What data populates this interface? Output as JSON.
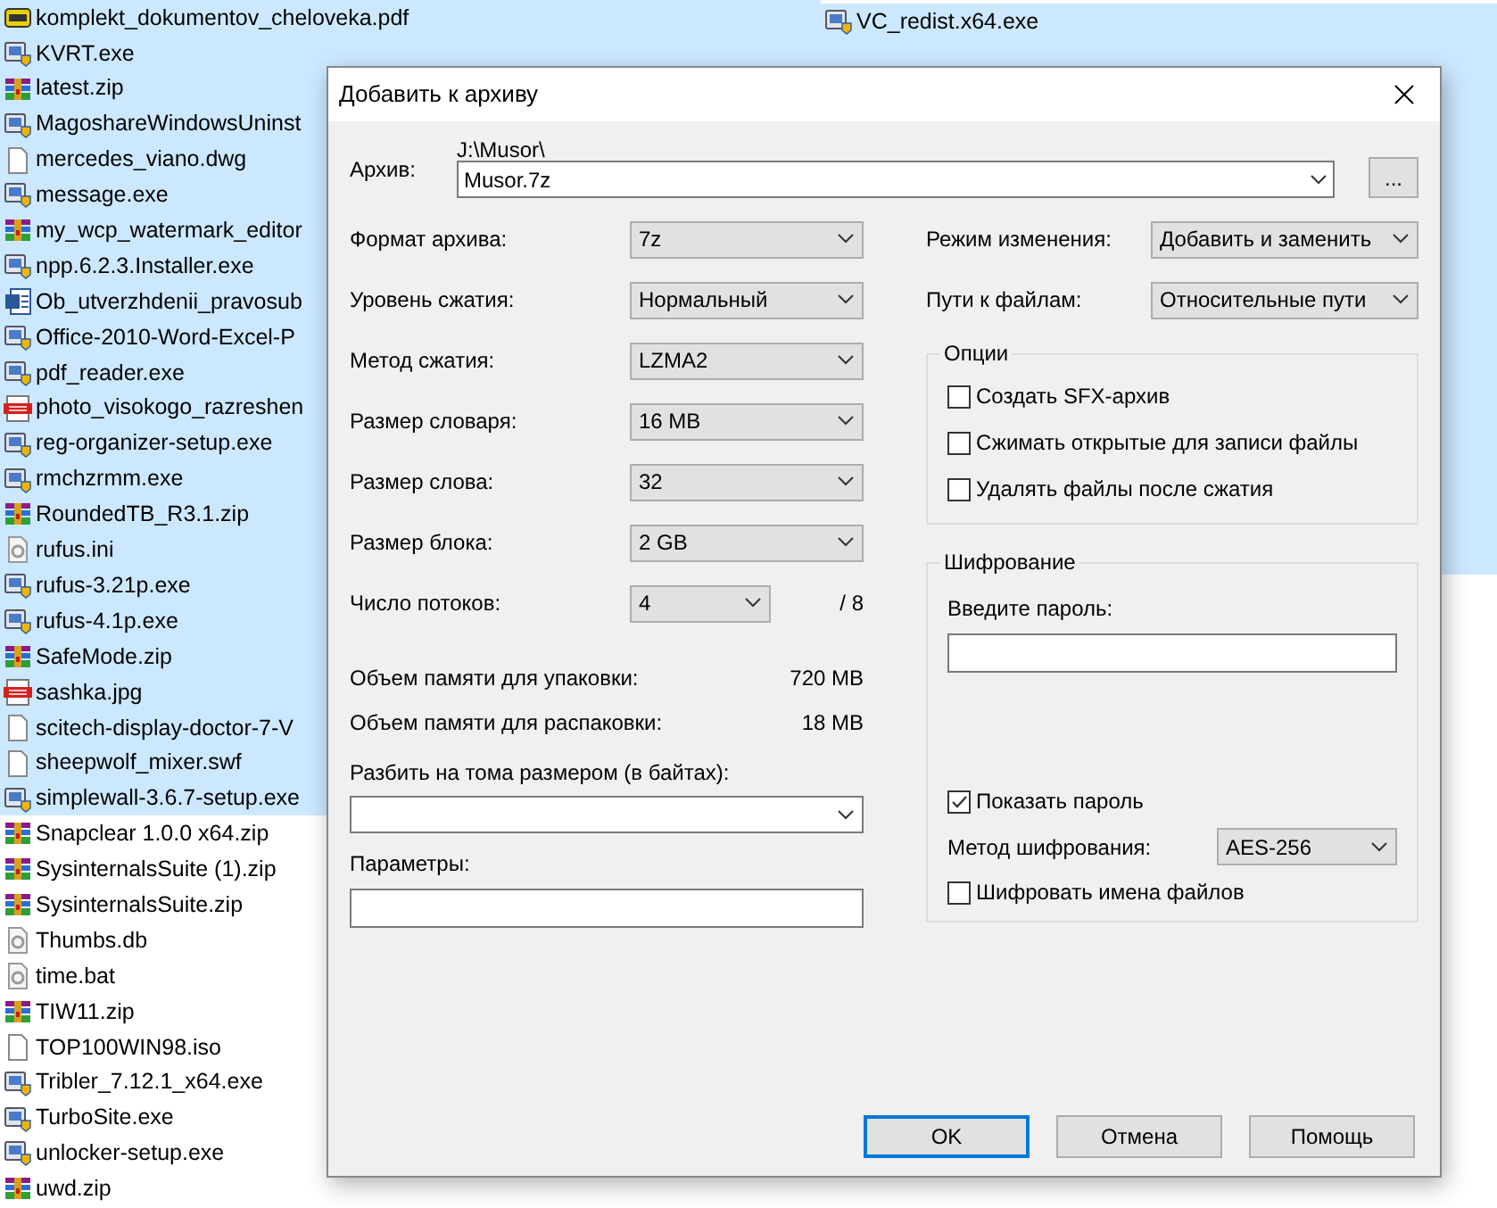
{
  "files_left": [
    {
      "name": "komplekt_dokumentov_cheloveka.pdf",
      "kind": "pdf",
      "selected": true
    },
    {
      "name": "KVRT.exe",
      "kind": "program",
      "selected": true
    },
    {
      "name": "latest.zip",
      "kind": "archive",
      "selected": true
    },
    {
      "name": "MagoshareWindowsUninst",
      "kind": "program",
      "selected": true
    },
    {
      "name": "mercedes_viano.dwg",
      "kind": "file",
      "selected": true
    },
    {
      "name": "message.exe",
      "kind": "program",
      "selected": true
    },
    {
      "name": "my_wcp_watermark_editor",
      "kind": "archive",
      "selected": true
    },
    {
      "name": "npp.6.2.3.Installer.exe",
      "kind": "program",
      "selected": true
    },
    {
      "name": "Ob_utverzhdenii_pravosub",
      "kind": "document",
      "selected": true
    },
    {
      "name": "Office-2010-Word-Excel-P",
      "kind": "program",
      "selected": true
    },
    {
      "name": "pdf_reader.exe",
      "kind": "program",
      "selected": true
    },
    {
      "name": "photo_visokogo_razreshen",
      "kind": "image",
      "selected": true
    },
    {
      "name": "reg-organizer-setup.exe",
      "kind": "program",
      "selected": true
    },
    {
      "name": "rmchzrmm.exe",
      "kind": "program",
      "selected": true
    },
    {
      "name": "RoundedTB_R3.1.zip",
      "kind": "archive",
      "selected": true
    },
    {
      "name": "rufus.ini",
      "kind": "settings",
      "selected": true
    },
    {
      "name": "rufus-3.21p.exe",
      "kind": "program",
      "selected": true
    },
    {
      "name": "rufus-4.1p.exe",
      "kind": "program",
      "selected": true
    },
    {
      "name": "SafeMode.zip",
      "kind": "archive",
      "selected": true
    },
    {
      "name": "sashka.jpg",
      "kind": "image",
      "selected": true
    },
    {
      "name": "scitech-display-doctor-7-V",
      "kind": "file",
      "selected": true
    },
    {
      "name": "sheepwolf_mixer.swf",
      "kind": "file",
      "selected": true
    },
    {
      "name": "simplewall-3.6.7-setup.exe",
      "kind": "program",
      "selected": true
    },
    {
      "name": "Snapclear 1.0.0 x64.zip",
      "kind": "archive",
      "selected": false
    },
    {
      "name": "SysinternalsSuite (1).zip",
      "kind": "archive",
      "selected": false
    },
    {
      "name": "SysinternalsSuite.zip",
      "kind": "archive",
      "selected": false
    },
    {
      "name": "Thumbs.db",
      "kind": "settings",
      "selected": false
    },
    {
      "name": "time.bat",
      "kind": "settings",
      "selected": false
    },
    {
      "name": "TIW11.zip",
      "kind": "archive",
      "selected": false
    },
    {
      "name": "TOP100WIN98.iso",
      "kind": "file",
      "selected": false
    },
    {
      "name": "Tribler_7.12.1_x64.exe",
      "kind": "program",
      "selected": false
    },
    {
      "name": "TurboSite.exe",
      "kind": "program",
      "selected": false
    },
    {
      "name": "unlocker-setup.exe",
      "kind": "program",
      "selected": false
    },
    {
      "name": "uwd.zip",
      "kind": "archive",
      "selected": false
    }
  ],
  "files_right": [
    {
      "name": "VC_redist.x64.exe",
      "kind": "program",
      "selected": true
    }
  ],
  "dialog": {
    "title": "Добавить к архиву",
    "archive": {
      "label": "Архив:",
      "path": "J:\\Musor\\",
      "value": "Musor.7z",
      "browse": "..."
    },
    "settings": [
      {
        "label": "Формат архива:",
        "value": "7z"
      },
      {
        "label": "Уровень сжатия:",
        "value": "Нормальный"
      },
      {
        "label": "Метод сжатия:",
        "value": "LZMA2"
      },
      {
        "label": "Размер словаря:",
        "value": "16 MB"
      },
      {
        "label": "Размер слова:",
        "value": "32"
      },
      {
        "label": "Размер блока:",
        "value": "2 GB"
      }
    ],
    "threads": {
      "label": "Число потоков:",
      "value": "4",
      "max": "/ 8"
    },
    "memory": [
      {
        "label": "Объем памяти для упаковки:",
        "value": "720 MB"
      },
      {
        "label": "Объем памяти для распаковки:",
        "value": "18 MB"
      }
    ],
    "split": {
      "label": "Разбить на тома размером (в байтах):"
    },
    "params": {
      "label": "Параметры:"
    },
    "modes": [
      {
        "label": "Режим изменения:",
        "value": "Добавить и заменить"
      },
      {
        "label": "Пути к файлам:",
        "value": "Относительные пути"
      }
    ],
    "options": {
      "title": "Опции",
      "items": [
        {
          "label": "Создать SFX-архив",
          "checked": false
        },
        {
          "label": "Сжимать открытые для записи файлы",
          "checked": false
        },
        {
          "label": "Удалять файлы после сжатия",
          "checked": false
        }
      ]
    },
    "encryption": {
      "title": "Шифрование",
      "password_label": "Введите пароль:",
      "show_password": {
        "label": "Показать пароль",
        "checked": true
      },
      "method": {
        "label": "Метод шифрования:",
        "value": "AES-256"
      },
      "encrypt_names": {
        "label": "Шифровать имена файлов",
        "checked": false
      }
    },
    "buttons": [
      {
        "label": "OK",
        "default": true
      },
      {
        "label": "Отмена",
        "default": false
      },
      {
        "label": "Помощь",
        "default": false
      }
    ]
  }
}
